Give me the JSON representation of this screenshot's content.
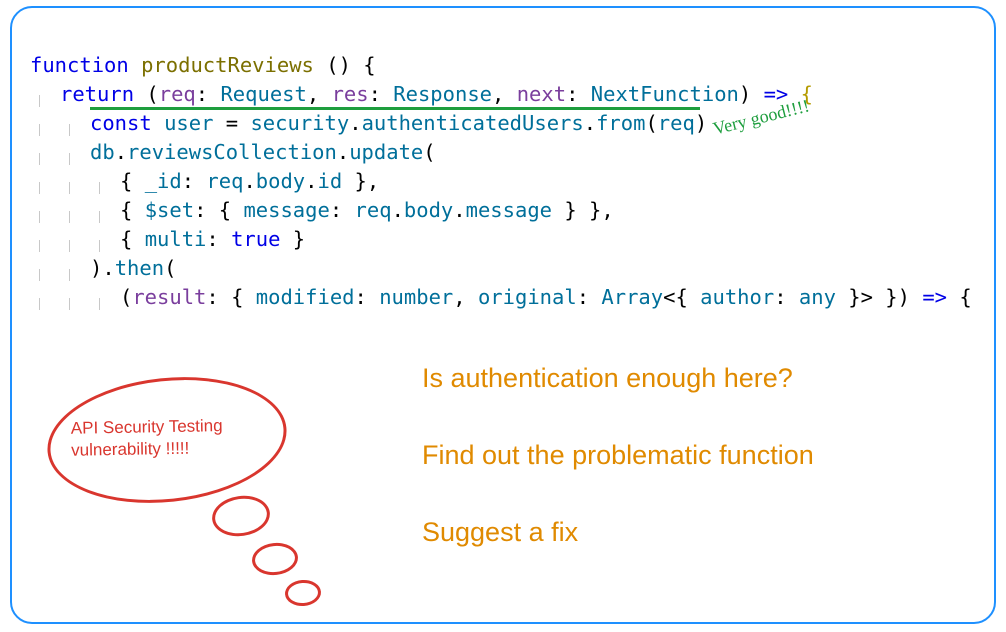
{
  "code": {
    "l1": {
      "kw1": "function",
      "fn": "productReviews",
      "rest": " () {"
    },
    "l2": {
      "kw": "return",
      "p1": "req",
      "t1": "Request",
      "p2": "res",
      "t2": "Response",
      "p3": "next",
      "t3": "NextFunction",
      "arrow": "=>"
    },
    "l3": {
      "kw": "const",
      "v": "user",
      "s1": "security",
      "s2": "authenticatedUsers",
      "s3": "from",
      "arg": "req"
    },
    "l4": {
      "a": "db",
      "b": "reviewsCollection",
      "c": "update"
    },
    "l5": {
      "k": "_id",
      "a": "req",
      "b": "body",
      "c": "id"
    },
    "l6": {
      "k1": "$set",
      "k2": "message",
      "a": "req",
      "b": "body",
      "c": "message"
    },
    "l7": {
      "k": "multi",
      "v": "true"
    },
    "l8": {
      "then": "then"
    },
    "l9": {
      "p": "result",
      "k1": "modified",
      "t1": "number",
      "k2": "original",
      "t2": "Array",
      "k3": "author",
      "t3": "any",
      "arrow": "=>"
    }
  },
  "annot": {
    "good": "Very good!!!!"
  },
  "questions": {
    "q1": "Is authentication enough here?",
    "q2": "Find out the problematic function",
    "q3": "Suggest a fix"
  },
  "bubble": {
    "line1": "API Security Testing",
    "line2": "vulnerability !!!!!"
  }
}
